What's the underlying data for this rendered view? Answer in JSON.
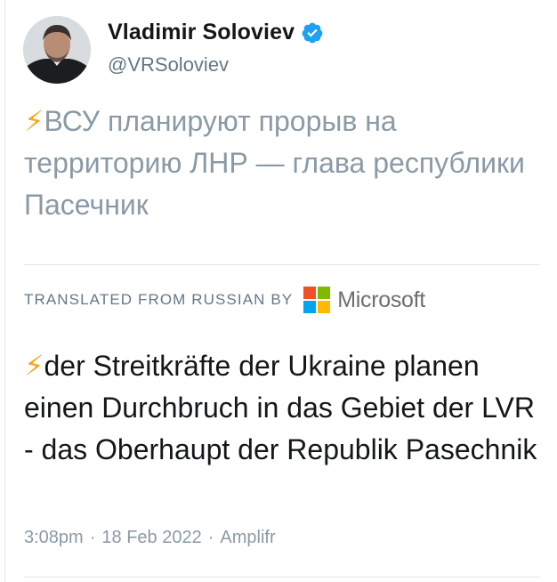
{
  "user": {
    "display_name": "Vladimir Soloviev",
    "handle": "@VRSoloviev",
    "verified_icon": "verified-badge-icon"
  },
  "tweet": {
    "bolt": "⚡",
    "original_text": "ВСУ планируют прорыв на территорию ЛНР — глава республики Пасечник",
    "translated_label": "TRANSLATED FROM RUSSIAN BY",
    "translator_name": "Microsoft",
    "translated_text": "der Streitkräfte der Ukraine planen einen Durchbruch in das Gebiet der LVR - das Oberhaupt der Republik Pasechnik",
    "time": "3:08pm",
    "date": "18 Feb 2022",
    "source": "Amplifr",
    "separator": "·"
  },
  "colors": {
    "verified": "#1da1f2",
    "bolt": "#f4a81c",
    "ms_red": "#f25022",
    "ms_green": "#7fba00",
    "ms_blue": "#00a4ef",
    "ms_yellow": "#ffb900"
  }
}
